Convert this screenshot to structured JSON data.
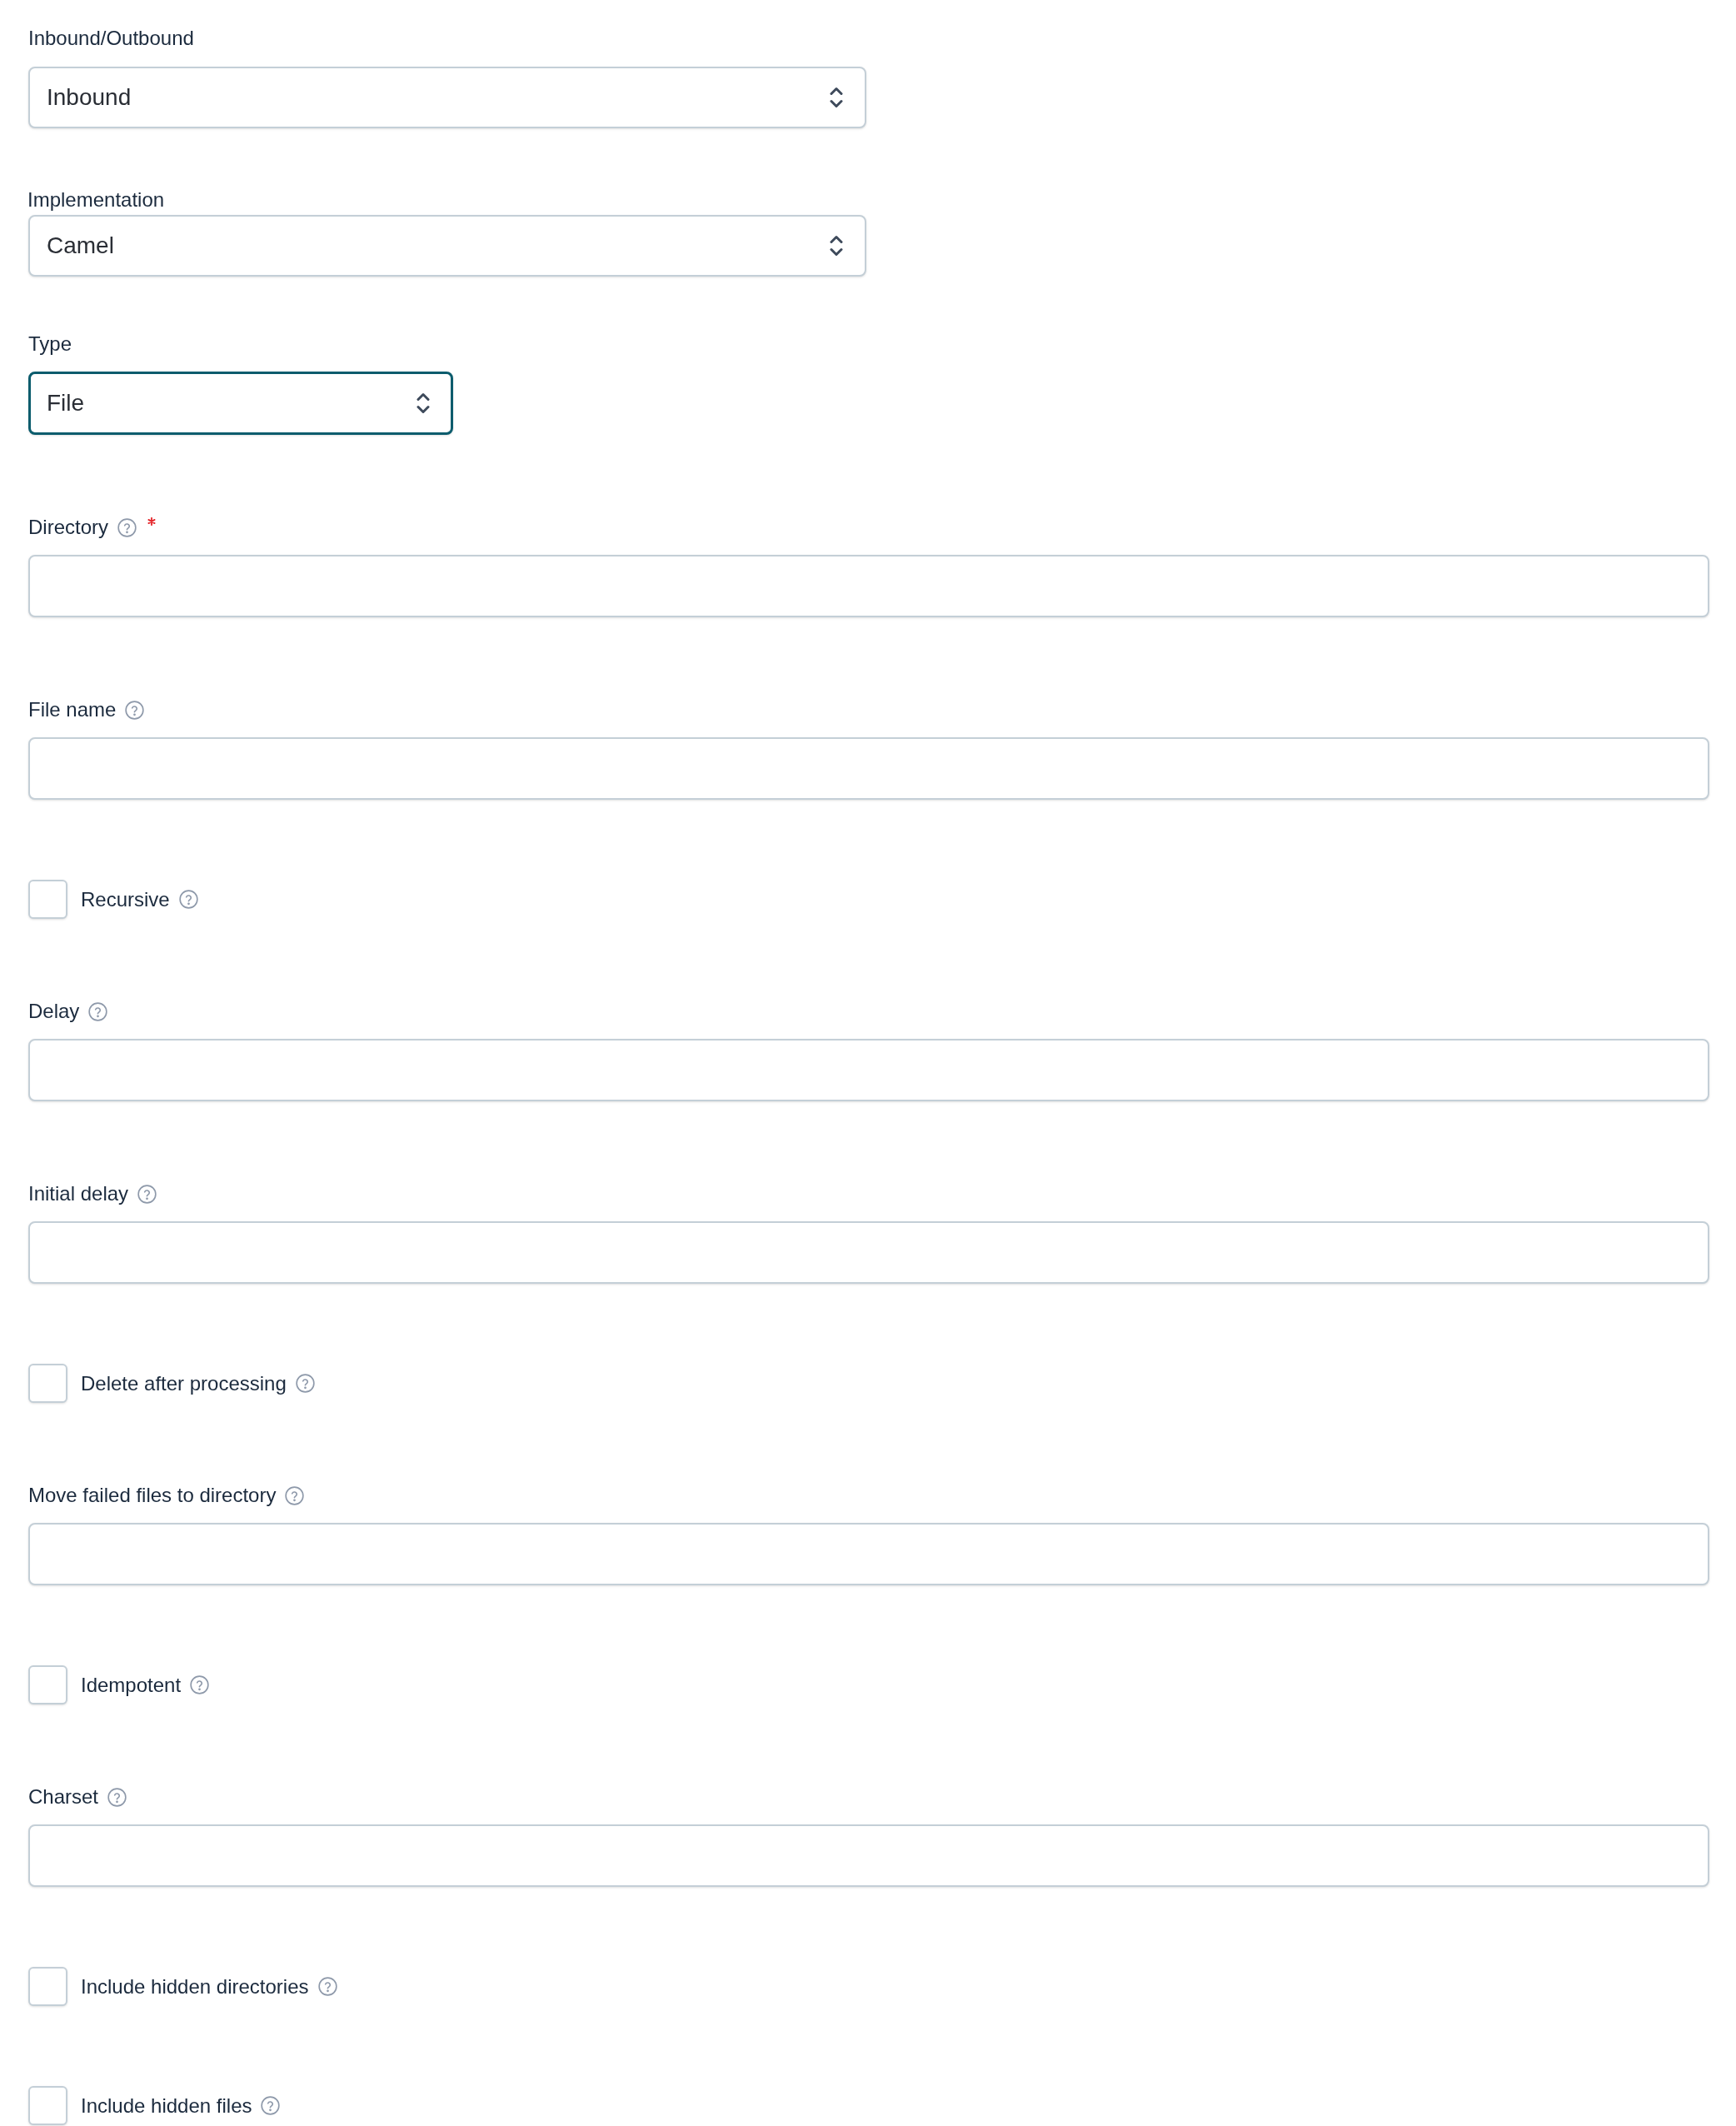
{
  "direction": {
    "label": "Inbound/Outbound",
    "value": "Inbound",
    "focused": false
  },
  "implementation": {
    "label": "Implementation",
    "value": "Camel",
    "focused": false
  },
  "type": {
    "label": "Type",
    "value": "File",
    "focused": true
  },
  "fields": [
    {
      "kind": "text",
      "label": "Directory",
      "help": true,
      "required": true
    },
    {
      "kind": "text",
      "label": "File name",
      "help": true,
      "required": false
    },
    {
      "kind": "checkbox",
      "label": "Recursive",
      "help": true,
      "checked": false
    },
    {
      "kind": "text",
      "label": "Delay",
      "help": true,
      "required": false
    },
    {
      "kind": "text",
      "label": "Initial delay",
      "help": true,
      "required": false
    },
    {
      "kind": "checkbox",
      "label": "Delete after processing",
      "help": true,
      "checked": false
    },
    {
      "kind": "text",
      "label": "Move failed files to directory",
      "help": true,
      "required": false
    },
    {
      "kind": "checkbox",
      "label": "Idempotent",
      "help": true,
      "checked": false
    },
    {
      "kind": "text",
      "label": "Charset",
      "help": true,
      "required": false
    },
    {
      "kind": "checkbox",
      "label": "Include hidden directories",
      "help": true,
      "checked": false
    },
    {
      "kind": "checkbox",
      "label": "Include hidden files",
      "help": true,
      "checked": false
    }
  ]
}
